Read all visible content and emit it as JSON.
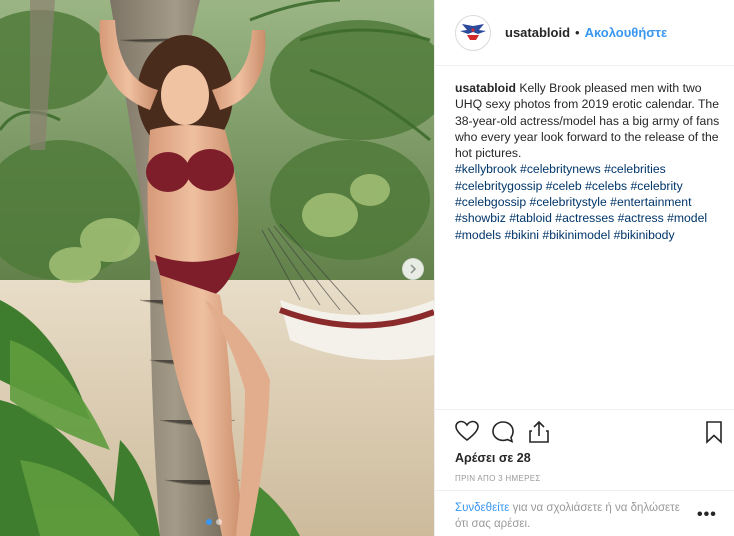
{
  "post": {
    "username": "usatabloid",
    "follow_label": "Ακολουθήστε",
    "separator": "•"
  },
  "caption": {
    "username": "usatabloid",
    "text": "Kelly Brook pleased men with two UHQ sexy photos from 2019 erotic calendar. The 38-year-old actress/model has a big army of fans who every year look forward to the release of the hot pictures.",
    "hashtags": [
      "#kellybrook",
      "#celebritynews",
      "#celebrities",
      "#celebritygossip",
      "#celeb",
      "#celebs",
      "#celebrity",
      "#celebgossip",
      "#celebritystyle",
      "#entertainment",
      "#showbiz",
      "#tabloid",
      "#actresses",
      "#actress",
      "#model",
      "#models",
      "#bikini",
      "#bikinimodel",
      "#bikinibody"
    ]
  },
  "engagement": {
    "likes": "Αρέσει σε 28",
    "timestamp": "ΠΡΙΝ ΑΠΟ 3 ΗΜΕΡΕΣ"
  },
  "comment_area": {
    "login_link": "Συνδεθείτε",
    "login_text": " για να σχολιάσετε ή να δηλώσετε ότι σας αρέσει.",
    "more": "•••"
  },
  "carousel": {
    "current_slide": 1,
    "total_slides": 2
  },
  "colors": {
    "accent": "#3897f0",
    "hashtag": "#003569",
    "muted": "#999999"
  },
  "icons": [
    "heart-icon",
    "comment-icon",
    "share-icon",
    "bookmark-icon",
    "chevron-right-icon",
    "more-options-icon"
  ]
}
